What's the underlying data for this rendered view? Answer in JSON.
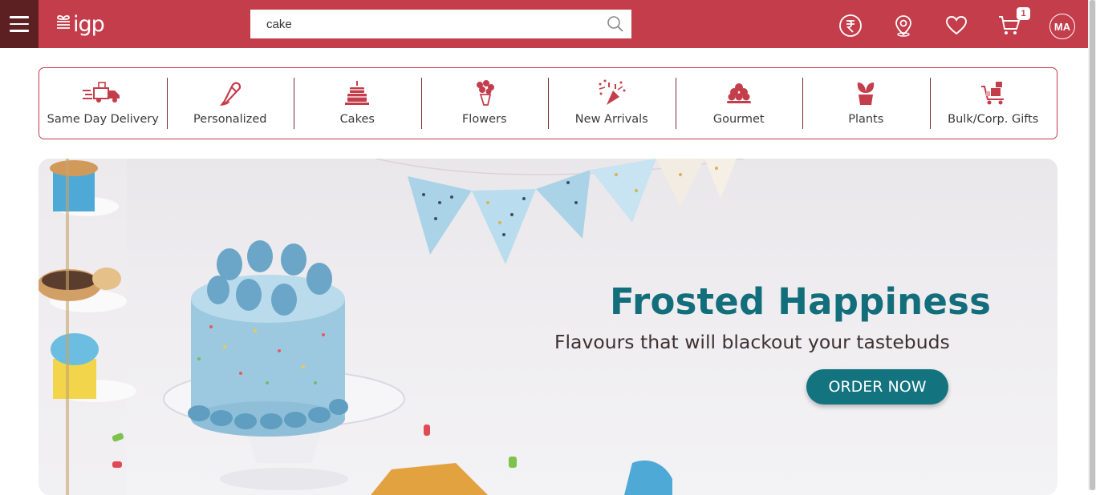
{
  "header": {
    "logo_text": "igp",
    "search": {
      "value": "cake",
      "placeholder": ""
    },
    "cart_count": "1",
    "avatar_initials": "MA",
    "colors": {
      "bar": "#c43d4b",
      "menu": "#5c1f22"
    },
    "icons": [
      "menu-icon",
      "search-icon",
      "rupee-icon",
      "location-icon",
      "heart-icon",
      "cart-icon"
    ]
  },
  "categories": [
    {
      "label": "Same Day Delivery",
      "icon": "delivery-truck-icon"
    },
    {
      "label": "Personalized",
      "icon": "pencil-icon"
    },
    {
      "label": "Cakes",
      "icon": "cake-icon"
    },
    {
      "label": "Flowers",
      "icon": "flowers-icon"
    },
    {
      "label": "New Arrivals",
      "icon": "party-popper-icon"
    },
    {
      "label": "Gourmet",
      "icon": "gourmet-icon"
    },
    {
      "label": "Plants",
      "icon": "plant-icon"
    },
    {
      "label": "Bulk/Corp. Gifts",
      "icon": "bulk-gifts-icon"
    }
  ],
  "hero": {
    "title": "Frosted Happiness",
    "subtitle": "Flavours that will blackout your tastebuds",
    "button": "ORDER NOW"
  }
}
